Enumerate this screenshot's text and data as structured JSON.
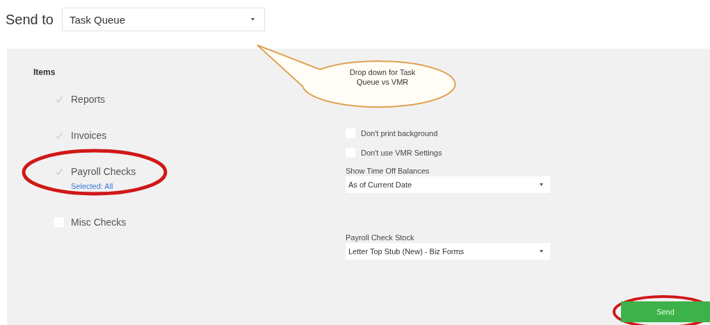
{
  "send_to": {
    "label": "Send to",
    "value": "Task Queue"
  },
  "items": {
    "title": "Items",
    "list": [
      {
        "label": "Reports",
        "checked": true
      },
      {
        "label": "Invoices",
        "checked": true
      },
      {
        "label": "Payroll Checks",
        "checked": true,
        "detail": "Selected: All",
        "highlighted": true
      },
      {
        "label": "Misc Checks",
        "checked": false
      }
    ]
  },
  "options": [
    {
      "label": "Don't print background",
      "checked": false
    },
    {
      "label": "Don't use VMR Settings",
      "checked": false
    }
  ],
  "selects": [
    {
      "label": "Show Time Off Balances",
      "value": "As of Current Date"
    },
    {
      "label": "Payroll Check Stock",
      "value": "Letter Top Stub (New) - Biz Forms"
    }
  ],
  "send_button": {
    "label": "Send",
    "highlighted": true
  },
  "callout": {
    "text": "Drop down for Task Queue vs VMR"
  }
}
